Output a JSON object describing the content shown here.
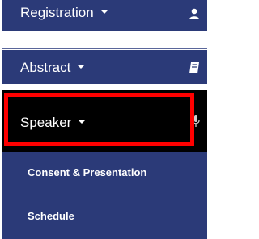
{
  "menu": {
    "items": [
      {
        "label": "Registration",
        "icon": "user-icon"
      },
      {
        "label": "Abstract",
        "icon": "book-icon"
      },
      {
        "label": "Speaker",
        "icon": "microphone-icon"
      }
    ],
    "speaker_subitems": [
      {
        "label": "Consent & Presentation"
      },
      {
        "label": "Schedule"
      }
    ]
  },
  "colors": {
    "menu_bg": "#2b3a78",
    "active_bg": "#000000",
    "highlight_border": "#ff0000",
    "text": "#ffffff"
  }
}
